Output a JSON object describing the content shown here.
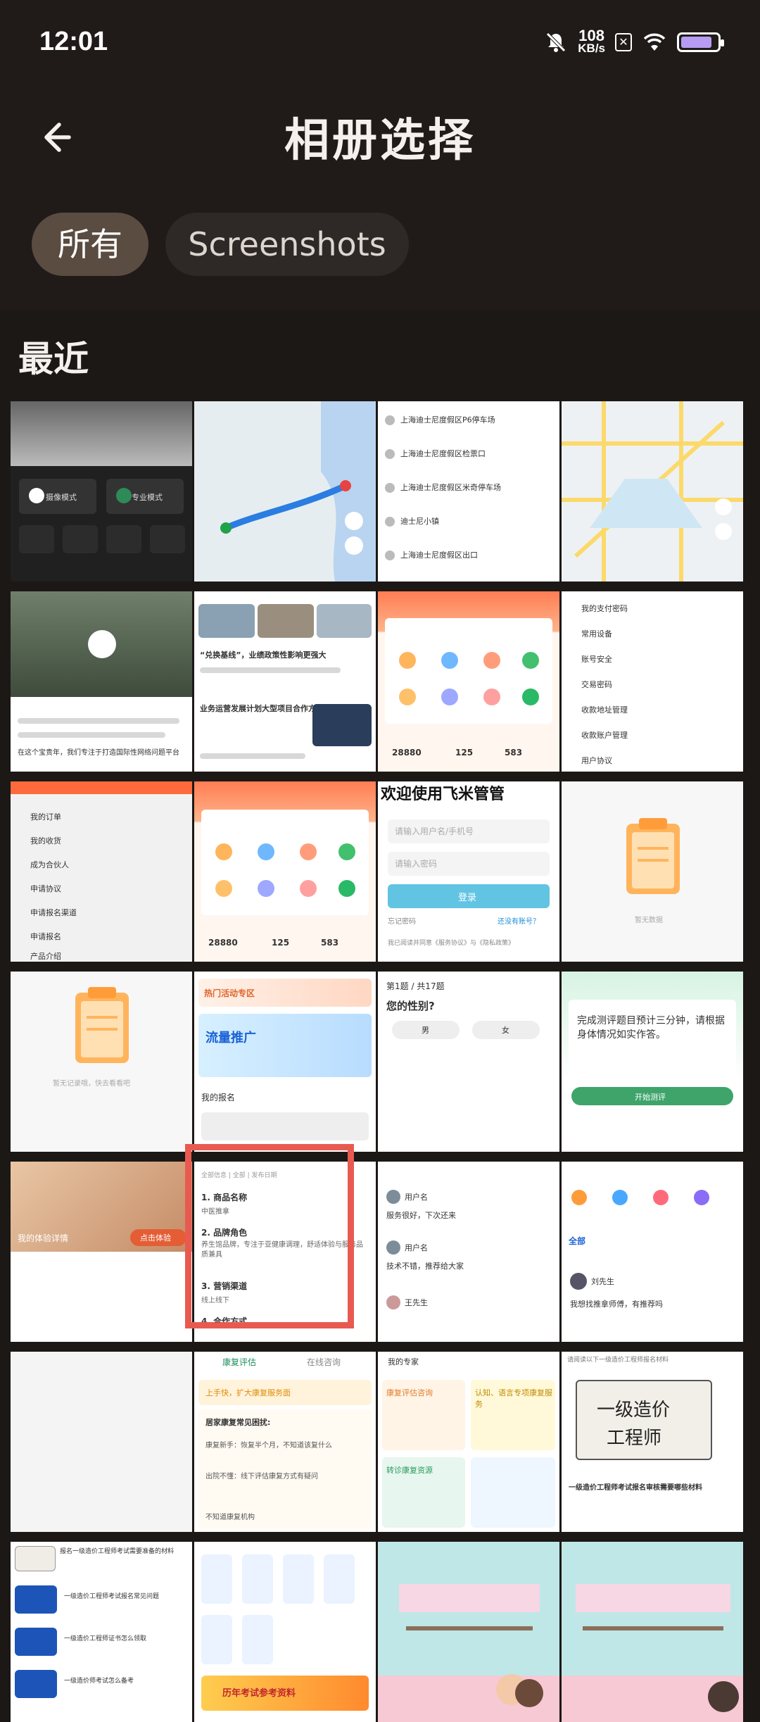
{
  "status_bar": {
    "time": "12:01",
    "speed_value": "108",
    "speed_unit": "KB/s",
    "battery_level": 0.85
  },
  "header": {
    "title": "相册选择"
  },
  "filters": [
    {
      "label": "所有",
      "active": true
    },
    {
      "label": "Screenshots",
      "active": false
    }
  ],
  "section": {
    "title": "最近"
  },
  "thumbs": {
    "t1_b1": "摄像模式",
    "t1_b2": "专业模式",
    "t3_l1": "上海迪士尼度假区P6停车场",
    "t3_l2": "上海迪士尼度假区检票口",
    "t3_l3": "上海迪士尼度假区米奇停车场",
    "t3_l4": "迪士尼小镇",
    "t3_l5": "上海迪士尼度假区出口",
    "t5_cap": "在这个宝贵年，我们专注于打造国际性网络问题平台",
    "t6_h1": "“兑换基线”，业绩政策性影响更强大",
    "t6_h2": "业务运营发展计划大型项目合作方案",
    "t7_stat": "28880",
    "t7_s2": "125",
    "t7_s3": "583",
    "t8_i1": "我的支付密码",
    "t8_i2": "常用设备",
    "t8_i3": "账号安全",
    "t8_i4": "交易密码",
    "t8_i5": "收款地址管理",
    "t8_i6": "收款账户管理",
    "t8_i7": "用户协议",
    "t9_i1": "我的订单",
    "t9_i2": "我的收货",
    "t9_i3": "成为合伙人",
    "t9_i4": "申请协议",
    "t9_i5": "申请报名渠道",
    "t9_i6": "申请报名",
    "t9_i7": "产品介绍",
    "t11_head": "欢迎使用飞米管管",
    "t11_f1": "请输入用户名/手机号",
    "t11_f2": "请输入密码",
    "t11_btn": "登录",
    "t11_l1": "忘记密码",
    "t11_l2": "还没有账号？",
    "t11_agree": "我已阅读并同意《服务协议》与《隐私政策》",
    "t12_cap": "暂无数据",
    "t13_cap": "暂无记录哦，快去看看吧",
    "t14_t1": "热门活动专区",
    "t14_banner": "流量推广",
    "t14_sec": "我的报名",
    "t15_q": "第1题 / 共17题",
    "t15_h": "您的性别?",
    "t15_a": "男",
    "t15_b": "女",
    "t16_main": "完成测评题目预计三分钟，请根据身体情况如实作答。",
    "t16_btn": "开始测评",
    "t17_cap": "我的体验详情",
    "t17_btn": "点击体验",
    "t18_meta": "全部信息 | 全部 | 发布日期",
    "t18_s1": "1. 商品名称",
    "t18_d1": "中医推拿",
    "t18_s2": "2. 品牌角色",
    "t18_d2": "养生馆品牌，专注于亚健康调理，舒适体验与服务品质兼具",
    "t18_s3": "3. 营销渠道",
    "t18_d3": "线上线下",
    "t18_s4": "4. 合作方式",
    "t19_u1": "用户名",
    "t19_p1": "服务很好，下次还来",
    "t19_u2": "用户名",
    "t19_p2": "技术不错，推荐给大家",
    "t19_u3": "王先生",
    "t20_tab": "全部",
    "t20_u": "刘先生",
    "t20_p": "我想找推拿师傅，有推荐吗",
    "t22_tab1": "康复评估",
    "t22_tab2": "在线咨询",
    "t22_h": "上手快，扩大康复服务面",
    "t22_s": "居家康复常见困扰:",
    "t22_i1": "康复新手：恢复半个月，不知道该复什么",
    "t22_i2": "出院不懂：线下评估康复方式有疑问",
    "t22_i3": "不知道康复机构",
    "t23_top": "我的专家",
    "t23_c1": "康复评估咨询",
    "t23_c2": "认知、语言专项康复服务",
    "t23_c3": "转诊康复资源",
    "t24_top": "请阅读以下一级造价工程师报名材料",
    "t24_cert1": "一级造价",
    "t24_cert2": "工程师",
    "t24_cap": "一级造价工程师考试报名审核需要哪些材料",
    "t25_l1": "报名一级造价工程师考试需要准备的材料",
    "t25_l2": "一级造价工程师考试报名常见问题",
    "t25_l3": "一级造价工程师证书怎么领取",
    "t25_l4": "一级造价师考试怎么备考",
    "t26_banner": "历年考试参考资料"
  }
}
